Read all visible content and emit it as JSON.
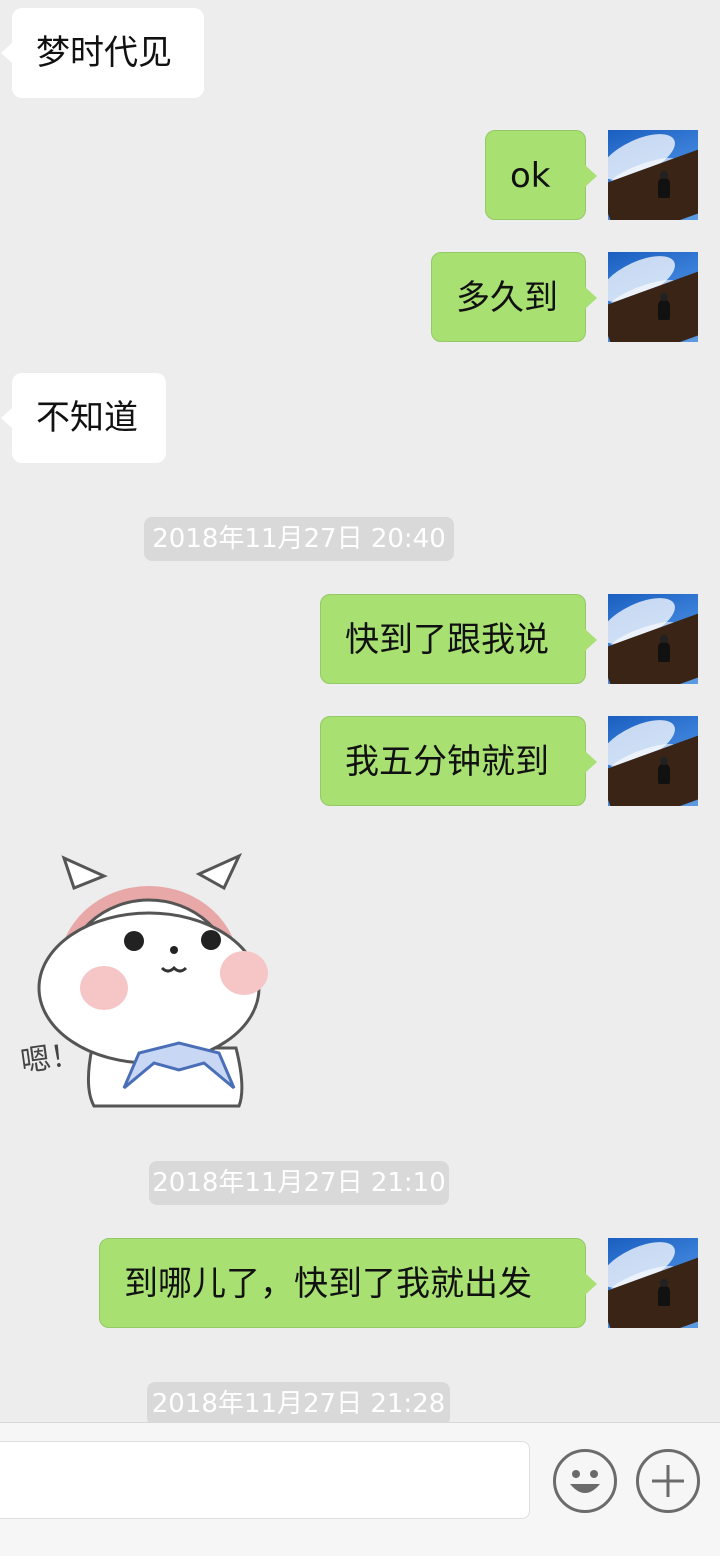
{
  "messages": [
    {
      "text": "梦时代见"
    },
    {
      "text": "ok"
    },
    {
      "text": "多久到"
    },
    {
      "text": "不知道"
    },
    {
      "text": "快到了跟我说"
    },
    {
      "text": "我五分钟就到"
    },
    {
      "text": "到哪儿了，快到了我就出发"
    }
  ],
  "timestamps": [
    "2018年11月27日 20:40",
    "2018年11月27日 21:10",
    "2018年11月27日 21:28"
  ],
  "sticker": {
    "text": "嗯！"
  },
  "input_bar": {
    "field_value": "",
    "emoji_icon": "emoji-icon",
    "plus_icon": "plus-icon"
  },
  "colors": {
    "background": "#ededed",
    "outgoing_bubble": "#a8e072",
    "incoming_bubble": "#ffffff",
    "timestamp_bg": "#d9d9d9"
  }
}
